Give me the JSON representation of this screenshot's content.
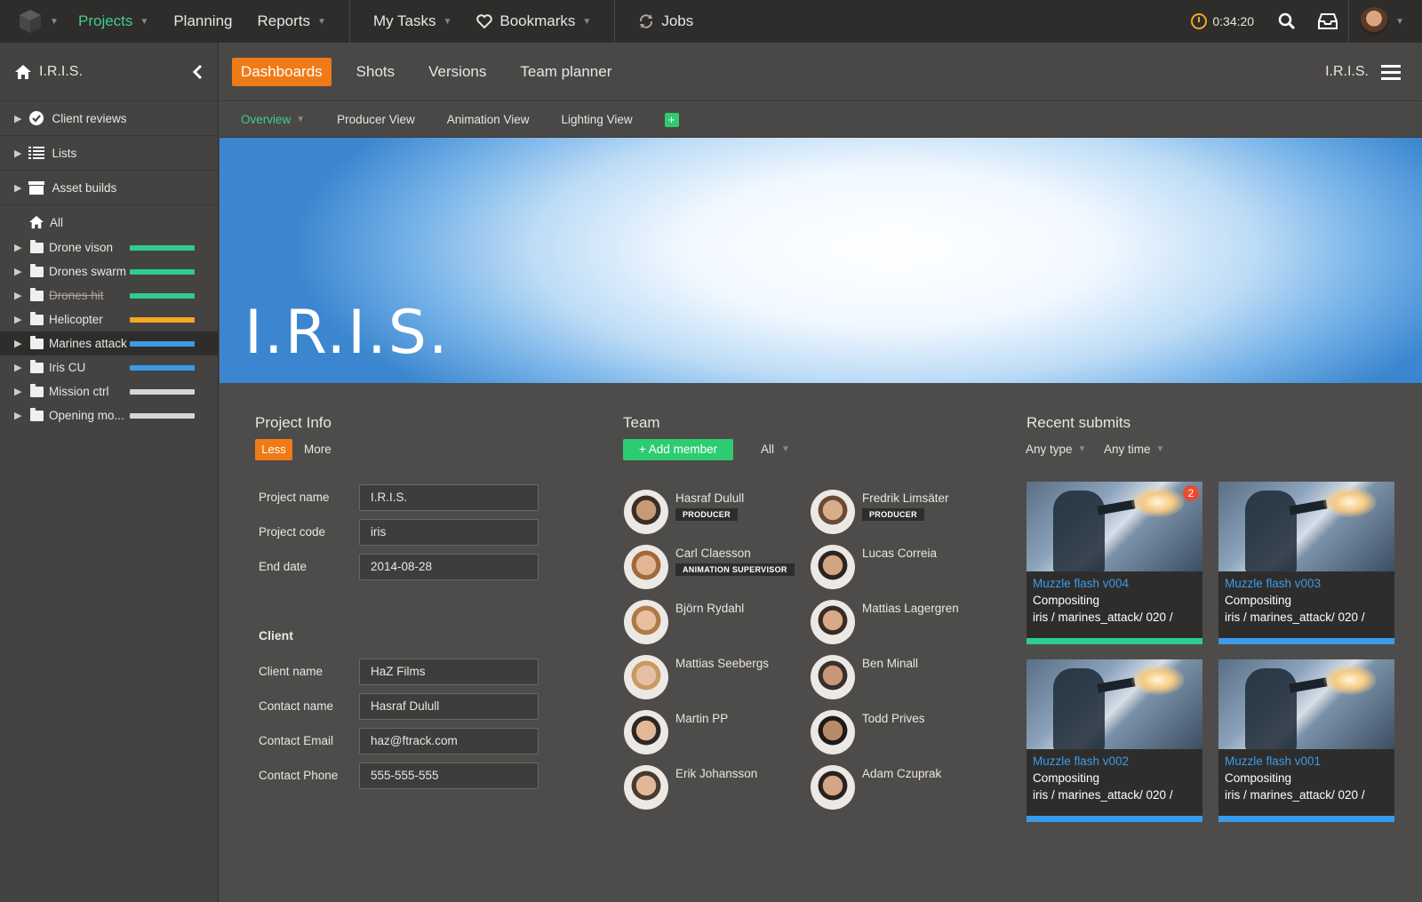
{
  "topnav": {
    "items": [
      {
        "label": "Projects",
        "active": true,
        "dropdown": true
      },
      {
        "label": "Planning",
        "active": false,
        "dropdown": false
      },
      {
        "label": "Reports",
        "active": false,
        "dropdown": true
      },
      {
        "label": "My Tasks",
        "active": false,
        "dropdown": true
      },
      {
        "label": "Bookmarks",
        "active": false,
        "dropdown": true
      },
      {
        "label": "Jobs",
        "active": false,
        "dropdown": false
      }
    ],
    "timer": "0:34:20",
    "icons": [
      "clock-icon",
      "search-icon",
      "inbox-icon",
      "user-avatar"
    ]
  },
  "sidebar": {
    "title": "I.R.I.S.",
    "sections": [
      {
        "label": "Client reviews",
        "icon": "check-circle-icon"
      },
      {
        "label": "Lists",
        "icon": "list-icon"
      },
      {
        "label": "Asset builds",
        "icon": "box-icon"
      }
    ],
    "tree_root": "All",
    "items": [
      {
        "label": "Drone vison",
        "color": "#2ecc8e",
        "strike": false,
        "selected": false
      },
      {
        "label": "Drones swarm",
        "color": "#2ecc8e",
        "strike": false,
        "selected": false
      },
      {
        "label": "Drones hit",
        "color": "#2ecc8e",
        "strike": true,
        "selected": false
      },
      {
        "label": "Helicopter",
        "color": "#f5a623",
        "strike": false,
        "selected": false
      },
      {
        "label": "Marines attack",
        "color": "#3a9be8",
        "strike": false,
        "selected": true
      },
      {
        "label": "Iris CU",
        "color": "#3a9be8",
        "strike": false,
        "selected": false
      },
      {
        "label": "Mission ctrl",
        "color": "#d8d6d4",
        "strike": false,
        "selected": false
      },
      {
        "label": "Opening mo...",
        "color": "#d8d6d4",
        "strike": false,
        "selected": false
      }
    ]
  },
  "tabs": {
    "items": [
      "Dashboards",
      "Shots",
      "Versions",
      "Team planner"
    ],
    "active": "Dashboards",
    "right_label": "I.R.I.S."
  },
  "subtabs": {
    "items": [
      "Overview",
      "Producer View",
      "Animation View",
      "Lighting View"
    ],
    "active": "Overview",
    "add_label": "+"
  },
  "hero": {
    "title": "I.R.I.S."
  },
  "project_info": {
    "title": "Project Info",
    "less_label": "Less",
    "more_label": "More",
    "fields": [
      {
        "label": "Project name",
        "value": "I.R.I.S."
      },
      {
        "label": "Project code",
        "value": "iris"
      },
      {
        "label": "End date",
        "value": "2014-08-28"
      }
    ],
    "client_heading": "Client",
    "client_fields": [
      {
        "label": "Client name",
        "value": "HaZ Films"
      },
      {
        "label": "Contact name",
        "value": "Hasraf Dulull"
      },
      {
        "label": "Contact Email",
        "value": "haz@ftrack.com"
      },
      {
        "label": "Contact Phone",
        "value": "555-555-555"
      }
    ]
  },
  "team": {
    "title": "Team",
    "add_label": "+ Add member",
    "filter_label": "All",
    "members": [
      {
        "name": "Hasraf Dulull",
        "role": "PRODUCER"
      },
      {
        "name": "Fredrik Limsäter",
        "role": "PRODUCER"
      },
      {
        "name": "Carl Claesson",
        "role": "ANIMATION SUPERVISOR"
      },
      {
        "name": "Lucas Correia",
        "role": ""
      },
      {
        "name": "Björn Rydahl",
        "role": ""
      },
      {
        "name": "Mattias Lagergren",
        "role": ""
      },
      {
        "name": "Mattias Seebergs",
        "role": ""
      },
      {
        "name": "Ben Minall",
        "role": ""
      },
      {
        "name": "Martin PP",
        "role": ""
      },
      {
        "name": "Todd Prives",
        "role": ""
      },
      {
        "name": "Erik Johansson",
        "role": ""
      },
      {
        "name": "Adam Czuprak",
        "role": ""
      }
    ]
  },
  "recent": {
    "title": "Recent submits",
    "type_filter": "Any type",
    "time_filter": "Any time",
    "cards": [
      {
        "title": "Muzzle flash v004",
        "type": "Compositing",
        "path": "iris / marines_attack/ 020 /",
        "status_color": "#2ecc8e",
        "badge": "2"
      },
      {
        "title": "Muzzle flash v003",
        "type": "Compositing",
        "path": "iris / marines_attack/ 020 /",
        "status_color": "#3a9be8",
        "badge": ""
      },
      {
        "title": "Muzzle flash v002",
        "type": "Compositing",
        "path": "iris / marines_attack/ 020 /",
        "status_color": "#3a9be8",
        "badge": ""
      },
      {
        "title": "Muzzle flash v001",
        "type": "Compositing",
        "path": "iris / marines_attack/ 020 /",
        "status_color": "#3a9be8",
        "badge": ""
      }
    ]
  },
  "colors": {
    "accent_orange": "#f07b16",
    "accent_green": "#2ecc71",
    "link_blue": "#3a9be8"
  }
}
